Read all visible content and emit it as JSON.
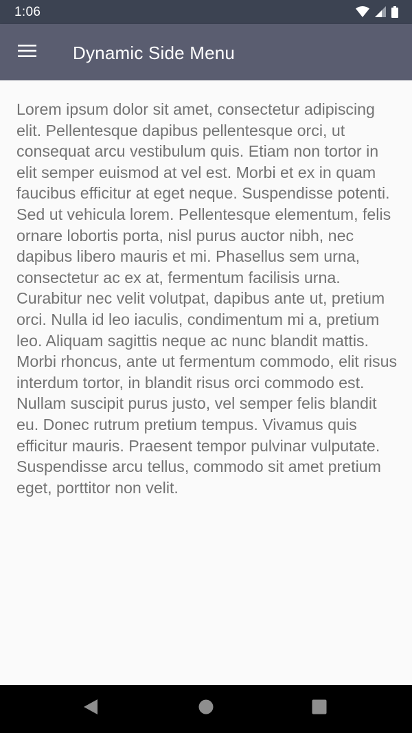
{
  "status_bar": {
    "time": "1:06",
    "icons": [
      "wifi-icon",
      "cell-signal-icon",
      "battery-icon"
    ]
  },
  "app_bar": {
    "menu_icon": "hamburger-menu-icon",
    "title": "Dynamic Side Menu"
  },
  "content": {
    "text": "Lorem ipsum dolor sit amet, consectetur adipiscing elit. Pellentesque dapibus pellentesque orci, ut consequat arcu vestibulum quis. Etiam non tortor in elit semper euismod at vel est. Morbi et ex in quam faucibus efficitur at eget neque. Suspendisse potenti. Sed ut vehicula lorem. Pellentesque elementum, felis ornare lobortis porta, nisl purus auctor nibh, nec dapibus libero mauris et mi. Phasellus sem urna, consectetur ac ex at, fermentum facilisis urna. Curabitur nec velit volutpat, dapibus ante ut, pretium orci. Nulla id leo iaculis, condimentum mi a, pretium leo. Aliquam sagittis neque ac nunc blandit mattis. Morbi rhoncus, ante ut fermentum commodo, elit risus interdum tortor, in blandit risus orci commodo est. Nullam suscipit purus justo, vel semper felis blandit eu. Donec rutrum pretium tempus. Vivamus quis efficitur mauris. Praesent tempor pulvinar vulputate. Suspendisse arcu tellus, commodo sit amet pretium eget, porttitor non velit."
  },
  "nav_bar": {
    "icons": [
      "back-icon",
      "home-icon",
      "recents-icon"
    ]
  },
  "colors": {
    "status_bar": "#3c4352",
    "app_bar": "#5a5d70",
    "background": "#fafafa",
    "body_text": "#737373",
    "nav_bar": "#000000",
    "nav_icons": "#8e8e8e"
  }
}
